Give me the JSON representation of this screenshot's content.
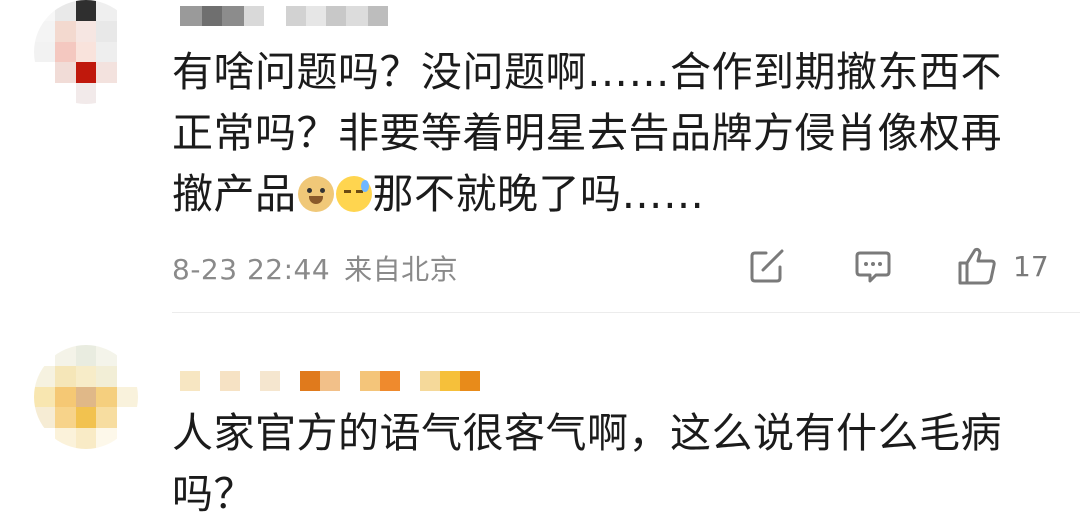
{
  "comments": [
    {
      "text_part1": "有啥问题吗？没问题啊……合作到期撤东西不正常吗？非要等着明星去告品牌方侵肖像权再撤产品",
      "text_part2": "那不就晚了吗……",
      "emojis": [
        "doge-emoji",
        "sweat-emoji"
      ],
      "time": "8-23 22:44",
      "location": "来自北京",
      "like_count": "17",
      "icons": [
        "share-icon",
        "comment-icon",
        "like-icon"
      ]
    },
    {
      "text": "人家官方的语气很客气啊，这么说有什么毛病吗？"
    }
  ],
  "colors": {
    "text": "#1b1b1b",
    "meta": "#8a8a8a",
    "divider": "#ececec"
  }
}
